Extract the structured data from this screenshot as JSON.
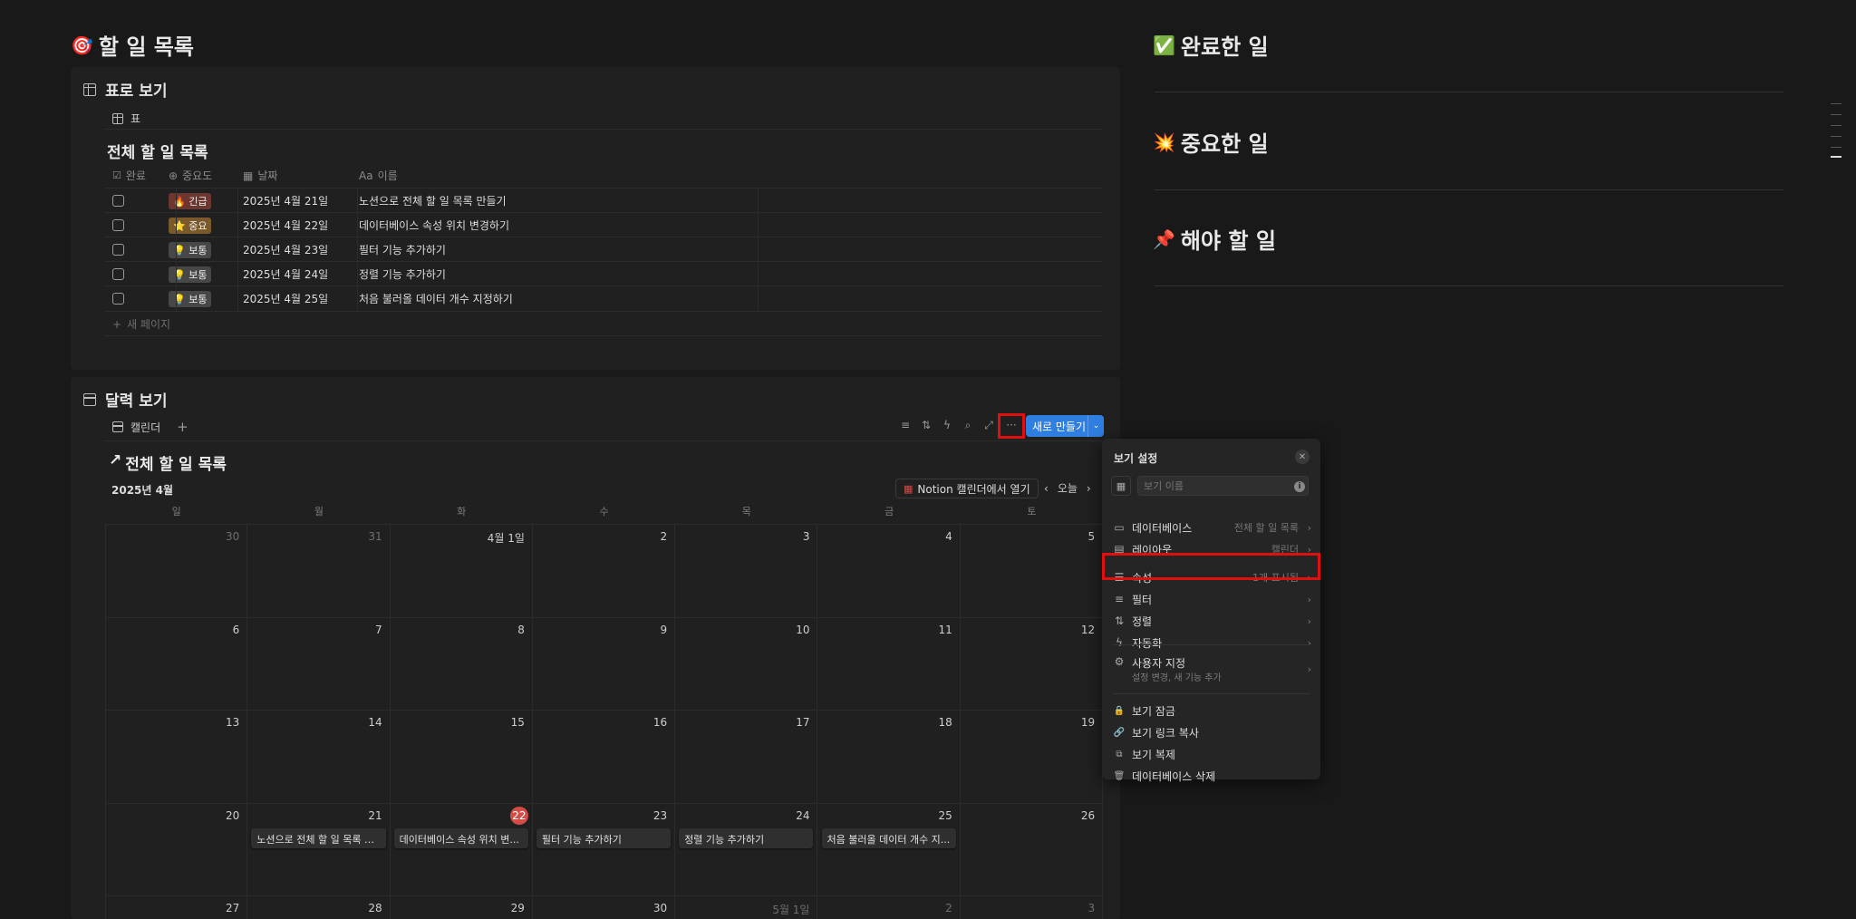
{
  "page": {
    "icon": "🎯",
    "title": "할 일 목록"
  },
  "table_block": {
    "title": "표로 보기",
    "tab": "표",
    "db_title": "전체 할 일 목록",
    "headers": {
      "done": "완료",
      "importance": "중요도",
      "date": "날짜",
      "name": "이름",
      "name_prefix": "Aa"
    },
    "rows": [
      {
        "tag": "🔥 긴급",
        "tag_color": "#6e3630",
        "date": "2025년 4월 21일",
        "name": "노션으로 전체 할 일 목록 만들기"
      },
      {
        "tag": "⭐ 중요",
        "tag_color": "#7a5a2a",
        "date": "2025년 4월 22일",
        "name": "데이터베이스 속성 위치 변경하기"
      },
      {
        "tag": "💡 보통",
        "tag_color": "#474747",
        "date": "2025년 4월 23일",
        "name": "필터 기능 추가하기"
      },
      {
        "tag": "💡 보통",
        "tag_color": "#474747",
        "date": "2025년 4월 24일",
        "name": "정렬 기능 추가하기"
      },
      {
        "tag": "💡 보통",
        "tag_color": "#474747",
        "date": "2025년 4월 25일",
        "name": "처음 불러올 데이터 개수 지정하기"
      }
    ],
    "new_page": "새 페이지"
  },
  "cal_block": {
    "title": "달력 보기",
    "tab": "캘린더",
    "new_button": "새로 만들기",
    "db_title": "전체 할 일 목록",
    "month": "2025년 4월",
    "open_notion": "Notion 캘린더에서 열기",
    "today": "오늘",
    "weekdays": [
      "일",
      "월",
      "화",
      "수",
      "목",
      "금",
      "토"
    ],
    "weeks": [
      [
        "30",
        "31",
        "4월 1일",
        "2",
        "3",
        "4",
        "5"
      ],
      [
        "6",
        "7",
        "8",
        "9",
        "10",
        "11",
        "12"
      ],
      [
        "13",
        "14",
        "15",
        "16",
        "17",
        "18",
        "19"
      ],
      [
        "20",
        "21",
        "22",
        "23",
        "24",
        "25",
        "26"
      ],
      [
        "27",
        "28",
        "29",
        "30",
        "5월 1일",
        "2",
        "3"
      ]
    ],
    "events": {
      "21": "노션으로 전체 할 일 목록 만...",
      "22": "데이터베이스 속성 위치 변...",
      "23": "필터 기능 추가하기",
      "24": "정렬 기능 추가하기",
      "25": "처음 불러올 데이터 개수 지..."
    }
  },
  "menu": {
    "title": "보기 설정",
    "name_placeholder": "보기 이름",
    "items": [
      {
        "icon": "▭",
        "label": "데이터베이스",
        "value": "전체 할 일 목록"
      },
      {
        "icon": "▤",
        "label": "레이아웃",
        "value": "캘린더"
      },
      {
        "icon": "☰",
        "label": "속성",
        "value": "1개 표시됨"
      },
      {
        "icon": "≡",
        "label": "필터",
        "value": ""
      },
      {
        "icon": "⇅",
        "label": "정렬",
        "value": ""
      },
      {
        "icon": "ϟ",
        "label": "자동화",
        "value": ""
      }
    ],
    "customize": {
      "label": "사용자 지정",
      "sub": "설정 변경, 새 기능 추가"
    },
    "actions": [
      {
        "icon": "🔒",
        "label": "보기 잠금"
      },
      {
        "icon": "🔗",
        "label": "보기 링크 복사"
      },
      {
        "icon": "⧉",
        "label": "보기 복제"
      },
      {
        "icon": "🗑",
        "label": "데이터베이스 삭제"
      }
    ]
  },
  "right": {
    "h1": {
      "icon": "✅",
      "title": "완료한 일"
    },
    "h2": {
      "icon": "💥",
      "title": "중요한 일"
    },
    "h3": {
      "icon": "📌",
      "title": "해야 할 일"
    }
  },
  "colors": {
    "highlight": "#e01010",
    "accent": "#2f7fe0",
    "today": "#d44c47"
  }
}
